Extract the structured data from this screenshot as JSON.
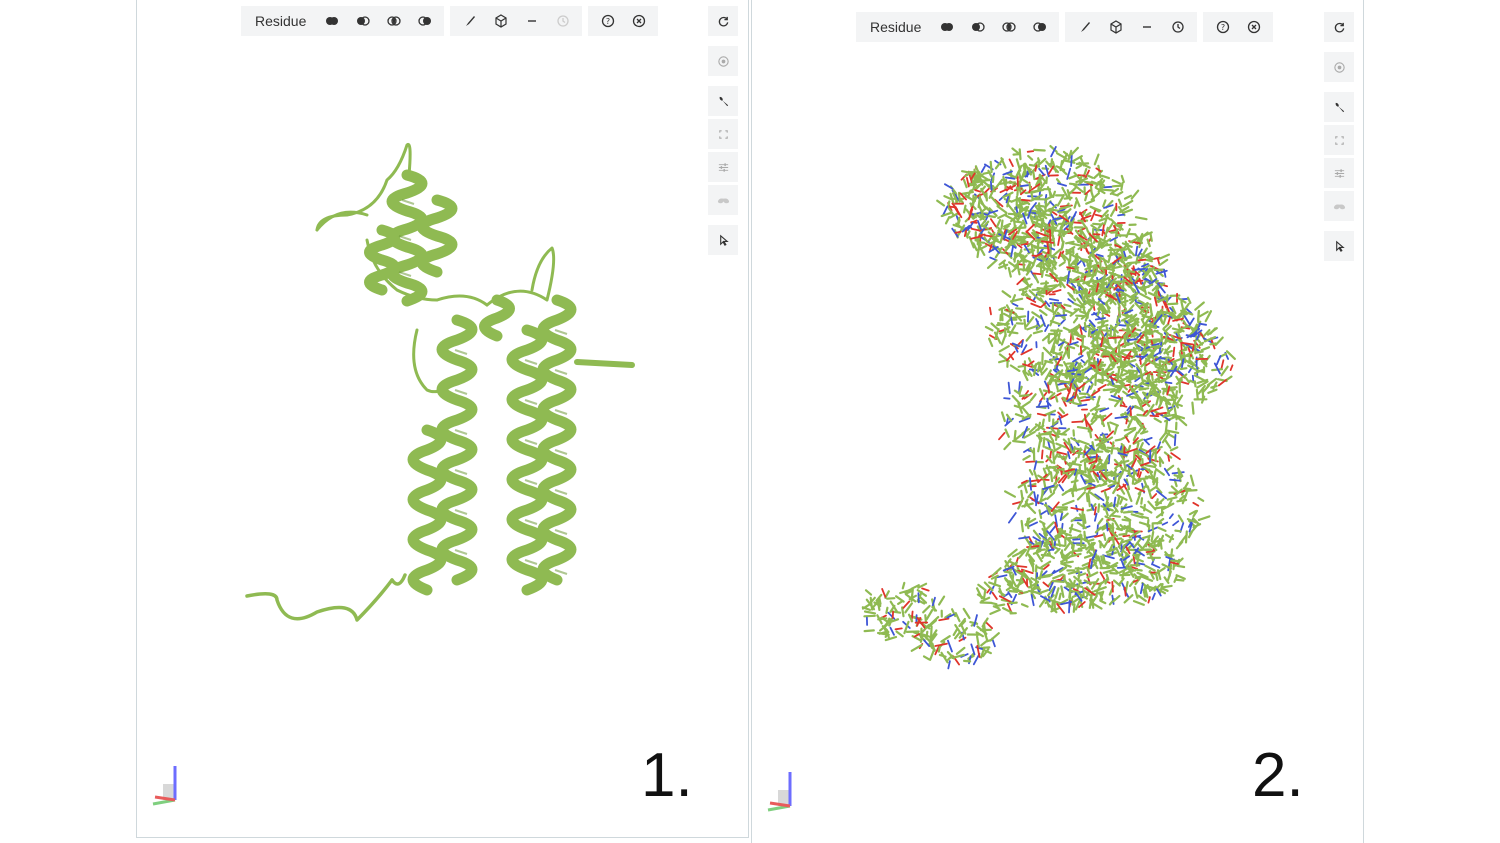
{
  "panels": [
    {
      "number": "1.",
      "toolbar": {
        "label": "Residue",
        "buttons": [
          "hide-all-icon",
          "hide-partial-icon",
          "split-view-icon",
          "show-partial-icon",
          "brush-icon",
          "cube-icon",
          "minus-icon",
          "history-icon",
          "help-icon",
          "close-circle-icon"
        ]
      },
      "side_buttons": [
        "refresh-icon",
        "settings-wheel-icon",
        "wrench-icon",
        "expand-icon",
        "sliders-icon",
        "glasses-icon",
        "cursor-icon"
      ],
      "representation": "cartoon",
      "history_enabled": false
    },
    {
      "number": "2.",
      "toolbar": {
        "label": "Residue",
        "buttons": [
          "hide-all-icon",
          "hide-partial-icon",
          "split-view-icon",
          "show-partial-icon",
          "brush-icon",
          "cube-icon",
          "minus-icon",
          "history-icon",
          "help-icon",
          "close-circle-icon"
        ]
      },
      "side_buttons": [
        "refresh-icon",
        "settings-wheel-icon",
        "wrench-icon",
        "expand-icon",
        "sliders-icon",
        "glasses-icon",
        "cursor-icon"
      ],
      "representation": "ball-and-stick",
      "history_enabled": true
    }
  ],
  "colors": {
    "protein_green": "#8fba52",
    "protein_dark": "#6f9a3a",
    "oxygen": "#e0342b",
    "nitrogen": "#3e56d6",
    "toolbar_bg": "#f3f4f5",
    "icon": "#333333",
    "icon_disabled": "#cccccc"
  }
}
